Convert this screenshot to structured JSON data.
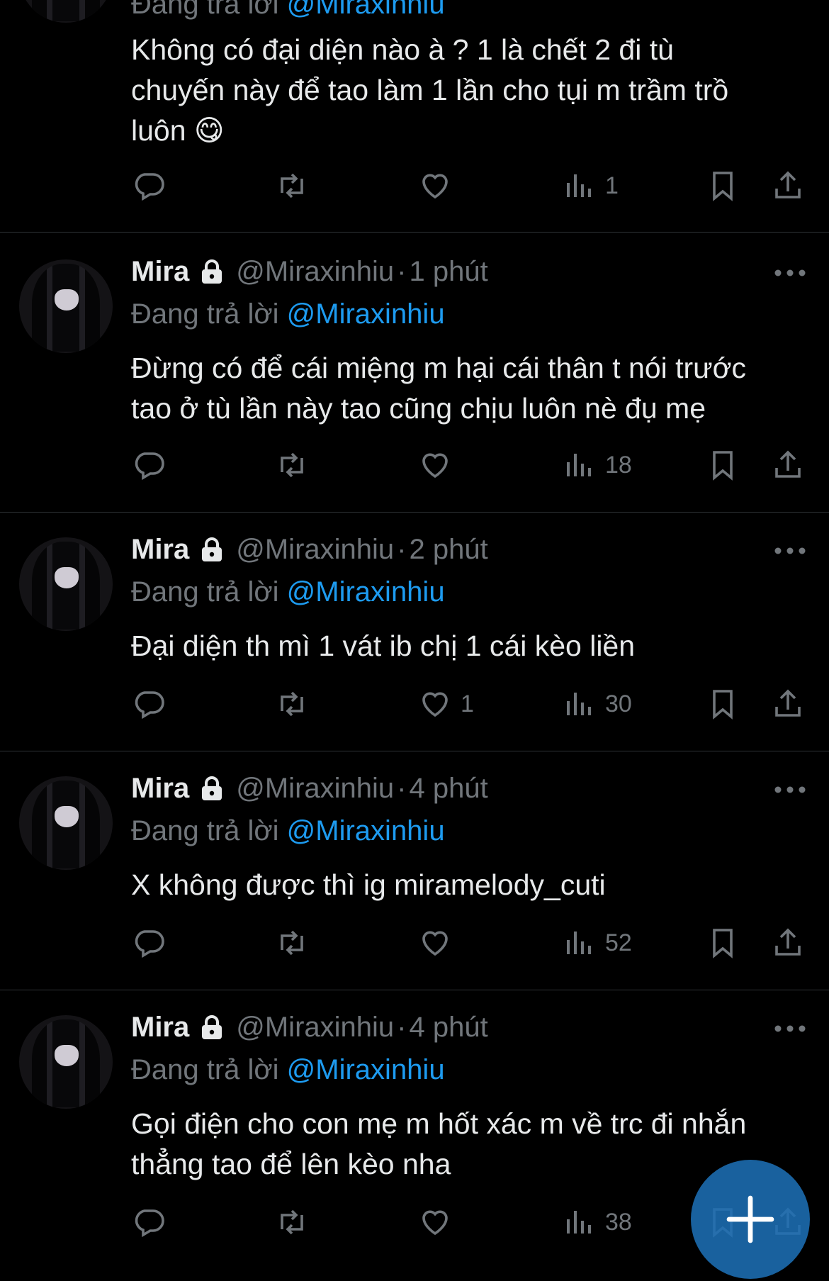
{
  "posts": [
    {
      "author_name": "",
      "handle": "",
      "time": "",
      "reply_label": "Đang trả lời",
      "reply_to": "@Miraxinhiu",
      "text": "Không có đại diện nào à ? 1 là chết 2 đi tù\nchuyến này để tao làm 1 lần cho tụi m trầm trồ\nluôn 😋",
      "replies": "",
      "reposts": "",
      "likes": "",
      "views": "1"
    },
    {
      "author_name": "Mira",
      "handle": "@Miraxinhiu",
      "time": "1 phút",
      "reply_label": "Đang trả lời",
      "reply_to": "@Miraxinhiu",
      "text": "Đừng có để cái miệng m hại cái thân t nói trước\ntao ở tù lần này tao cũng chịu luôn nè đụ mẹ",
      "replies": "",
      "reposts": "",
      "likes": "",
      "views": "18"
    },
    {
      "author_name": "Mira",
      "handle": "@Miraxinhiu",
      "time": "2 phút",
      "reply_label": "Đang trả lời",
      "reply_to": "@Miraxinhiu",
      "text": "Đại diện th mì 1 vát ib chị 1 cái kèo liền",
      "replies": "",
      "reposts": "",
      "likes": "1",
      "views": "30"
    },
    {
      "author_name": "Mira",
      "handle": "@Miraxinhiu",
      "time": "4 phút",
      "reply_label": "Đang trả lời",
      "reply_to": "@Miraxinhiu",
      "text": "X không được thì  ig miramelody_cuti",
      "replies": "",
      "reposts": "",
      "likes": "",
      "views": "52"
    },
    {
      "author_name": "Mira",
      "handle": "@Miraxinhiu",
      "time": "4 phút",
      "reply_label": "Đang trả lời",
      "reply_to": "@Miraxinhiu",
      "text": "Gọi điện cho con mẹ m hốt xác m về trc đi nhắn\nthẳng tao để lên kèo nha",
      "replies": "",
      "reposts": "",
      "likes": "",
      "views": "38"
    }
  ],
  "separator": "·",
  "icons": {
    "reply": "reply-icon",
    "repost": "repost-icon",
    "like": "heart-icon",
    "views": "views-icon",
    "bookmark": "bookmark-icon",
    "share": "share-icon",
    "lock": "lock-icon",
    "more": "more-icon",
    "compose": "compose-plus-icon"
  },
  "colors": {
    "background": "#000000",
    "text": "#e7e9ea",
    "muted": "#71767b",
    "mention": "#1d9bf0",
    "fab": "#1d6eb4"
  }
}
